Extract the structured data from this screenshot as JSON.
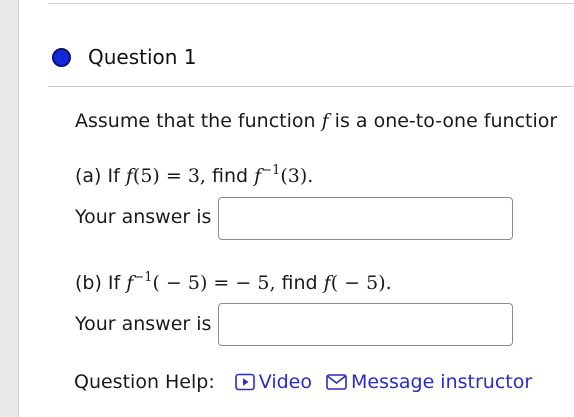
{
  "question": {
    "title": "Question 1",
    "prompt": "Assume that the function f is a one-to-one function",
    "part_a": {
      "lead": "(a) If",
      "condition": "f(5) = 3",
      "find_word": "find",
      "target": "f⁻¹(3).",
      "answer_label": "Your answer is",
      "answer_value": ""
    },
    "part_b": {
      "lead": "(b) If",
      "condition": "f⁻¹(−5) = −5",
      "find_word": "find",
      "target": "f(−5).",
      "answer_label": "Your answer is",
      "answer_value": ""
    }
  },
  "help": {
    "label": "Question Help:",
    "video_label": "Video",
    "message_label": "Message instructor",
    "video_icon": "play-icon",
    "message_icon": "envelope-icon"
  },
  "colors": {
    "link": "#2b2bc8",
    "status_dot": "#1428d8"
  }
}
